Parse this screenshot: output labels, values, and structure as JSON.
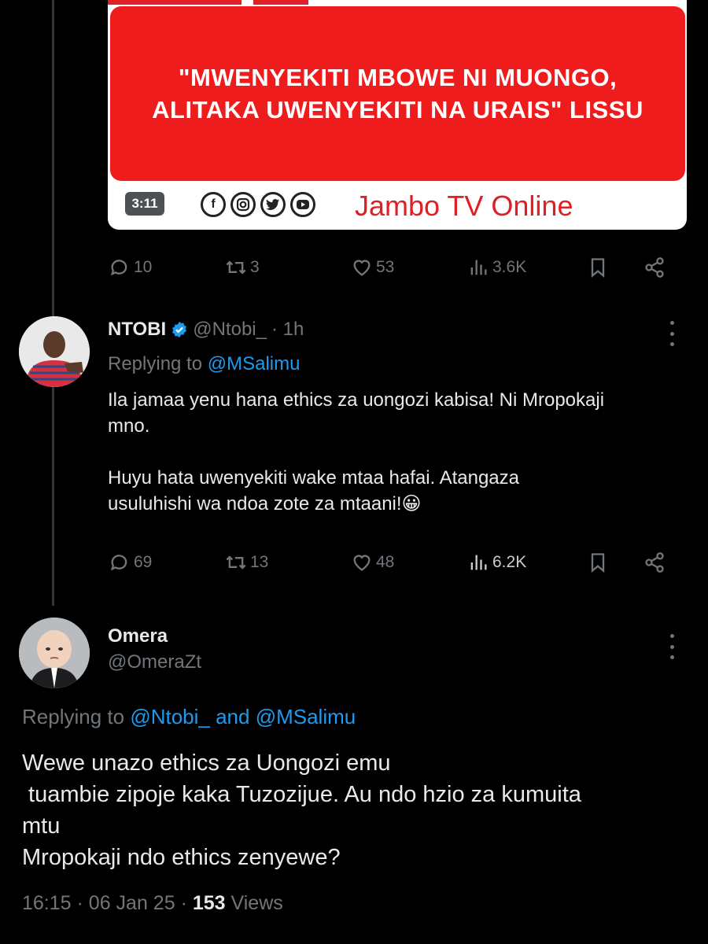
{
  "media": {
    "headline_line1": "\"MWENYEKITI MBOWE NI MUONGO,",
    "headline_line2": "ALITAKA UWENYEKITI NA URAIS\" LISSU",
    "duration": "3:11",
    "brand": "Jambo TV Online",
    "social_icons": [
      "facebook-icon",
      "instagram-icon",
      "twitter-icon",
      "youtube-icon"
    ],
    "colors": {
      "red": "#ee1c1c",
      "brand_red": "#e01f25"
    }
  },
  "tweet0": {
    "replies": "10",
    "retweets": "3",
    "likes": "53",
    "views": "3.6K"
  },
  "reply1": {
    "name": "NTOBI",
    "handle": "@Ntobi_",
    "time": "· 1h",
    "replying_prefix": "Replying to",
    "replying_to": "@MSalimu",
    "text_line1": "Ila jamaa yenu hana ethics za uongozi kabisa! Ni Mropokaji",
    "text_line2": "mno.",
    "text_line3": "Huyu hata uwenyekiti wake mtaa hafai. Atangaza",
    "text_line4": "usuluhishi wa ndoa zote za mtaani!😀",
    "replies": "69",
    "retweets": "13",
    "likes": "48",
    "views": "6.2K"
  },
  "reply2": {
    "name": "Omera",
    "handle": "@OmeraZt",
    "replying_prefix": "Replying to",
    "replying_to": "@Ntobi_ and @MSalimu",
    "text_line1": "Wewe unazo ethics za Uongozi emu",
    "text_line2": " tuambie zipoje kaka Tuzozijue. Au ndo hzio za kumuita",
    "text_line3": "mtu",
    "text_line4": "Mropokaji ndo ethics zenyewe?",
    "time": "16:15",
    "date": "06 Jan 25",
    "views_count": "153",
    "views_label": "Views"
  },
  "colors": {
    "background": "#000000",
    "link": "#1d9bf0",
    "muted": "#71767b",
    "text": "#e7e9ea"
  }
}
